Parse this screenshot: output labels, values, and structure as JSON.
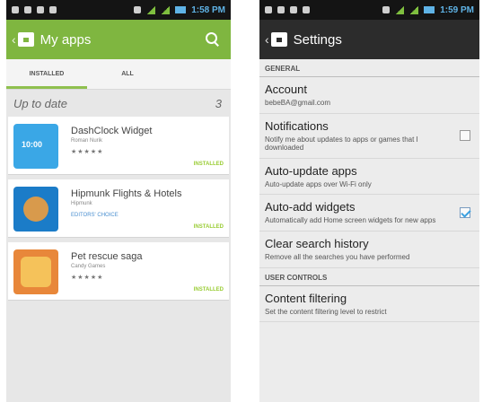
{
  "left_phone": {
    "status_time": "1:58 PM",
    "title": "My apps",
    "tabs": [
      {
        "label": "INSTALLED",
        "active": true
      },
      {
        "label": "ALL",
        "active": false
      }
    ],
    "section_title": "Up to date",
    "section_count": "3",
    "apps": [
      {
        "title": "DashClock Widget",
        "developer": "Roman Nurik",
        "stars": "★★★★★",
        "badge": "",
        "status": "INSTALLED"
      },
      {
        "title": "Hipmunk Flights & Hotels",
        "developer": "Hipmunk",
        "stars": "",
        "badge": "EDITORS' CHOICE",
        "status": "INSTALLED"
      },
      {
        "title": "Pet rescue saga",
        "developer": "Candy Games",
        "stars": "★★★★★",
        "badge": "",
        "status": "INSTALLED"
      }
    ],
    "accent_color": "#7fb640"
  },
  "right_phone": {
    "status_time": "1:59 PM",
    "title": "Settings",
    "sections": {
      "general": "GENERAL",
      "user_controls": "USER CONTROLS"
    },
    "settings": [
      {
        "title": "Account",
        "subtitle": "bebeBA@gmail.com"
      },
      {
        "title": "Notifications",
        "subtitle": "Notify me about updates to apps or games that I downloaded",
        "checked": false
      },
      {
        "title": "Auto-update apps",
        "subtitle": "Auto-update apps over Wi-Fi only"
      },
      {
        "title": "Auto-add widgets",
        "subtitle": "Automatically add Home screen widgets for new apps",
        "checked": true
      },
      {
        "title": "Clear search history",
        "subtitle": "Remove all the searches you have performed"
      },
      {
        "title": "Content filtering",
        "subtitle": "Set the content filtering level to restrict"
      }
    ]
  }
}
